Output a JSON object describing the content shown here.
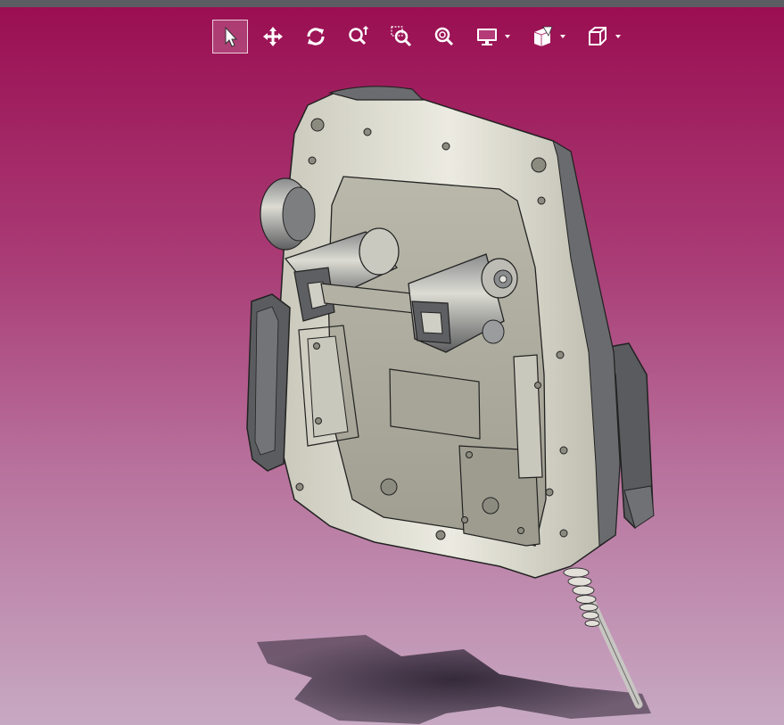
{
  "window": {
    "topbar_color": "#5b5d62"
  },
  "viewport": {
    "background_top": "#9a0f52",
    "background_bottom": "#c7a9c3"
  },
  "toolbar": {
    "tools": [
      {
        "icon": "select-arrow-icon",
        "active": true
      },
      {
        "icon": "pan-move-icon",
        "active": false
      },
      {
        "icon": "rotate-icon",
        "active": false
      },
      {
        "icon": "zoom-in-out-icon",
        "active": false
      },
      {
        "icon": "zoom-area-icon",
        "active": false
      },
      {
        "icon": "zoom-fit-icon",
        "active": false
      },
      {
        "icon": "display-monitor-icon",
        "active": false,
        "dropdown": true
      },
      {
        "icon": "section-view-icon",
        "active": false,
        "dropdown": true
      },
      {
        "icon": "view-cube-icon",
        "active": false,
        "dropdown": true
      }
    ]
  },
  "model": {
    "body_color": "#dcdbd0",
    "panel_color": "#a8a79a",
    "dark_color": "#55565a",
    "shadow_color": "#3a3040"
  }
}
